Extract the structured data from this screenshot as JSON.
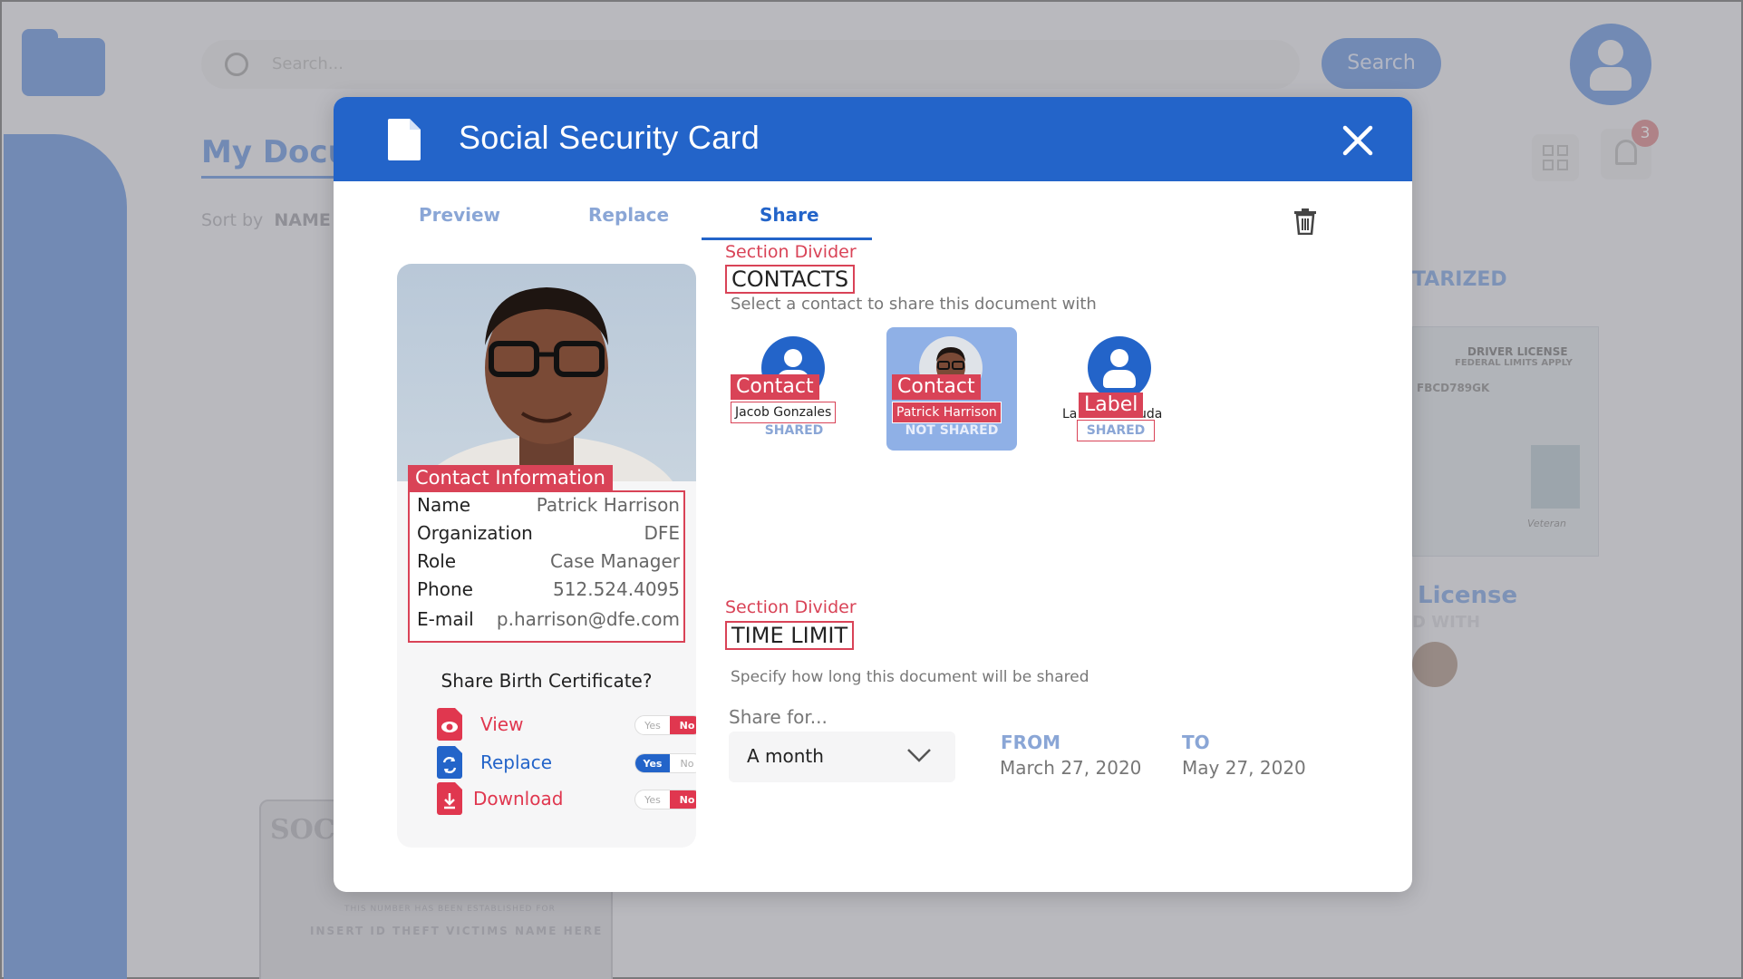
{
  "background": {
    "search_placeholder": "Search...",
    "search_button": "Search",
    "page_title": "My Docu",
    "sort_by_label": "Sort by",
    "sort_by_value": "NAME",
    "notification_count": "3",
    "notarized_label": "TARIZED",
    "dl_card_line1": "DRIVER LICENSE",
    "dl_card_line2": "FEDERAL LIMITS APPLY",
    "dl_card_line3": "FBCD789GK",
    "dl_card_veteran": "Veteran",
    "license_title": "License",
    "shared_with_label": "D WITH",
    "ssc_card_soc": "SOC",
    "ssc_card_line1": "THIS NUMBER HAS BEEN ESTABLISHED FOR",
    "ssc_card_line2": "INSERT ID THEFT VICTIMS NAME HERE"
  },
  "modal": {
    "title": "Social Security Card",
    "tabs": [
      {
        "label": "Preview"
      },
      {
        "label": "Replace"
      },
      {
        "label": "Share"
      }
    ],
    "active_tab": "Share"
  },
  "profile": {
    "contact_info_tag": "Contact Information",
    "fields": [
      {
        "key": "Name",
        "value": "Patrick Harrison"
      },
      {
        "key": "Organization",
        "value": "DFE"
      },
      {
        "key": "Role",
        "value": "Case Manager"
      },
      {
        "key": "Phone",
        "value": "512.524.4095"
      },
      {
        "key": "E-mail",
        "value": "p.harrison@dfe.com"
      }
    ],
    "share_question": "Share Birth Certificate?",
    "permissions": [
      {
        "label": "View",
        "yes": "Yes",
        "no": "No",
        "state": "no"
      },
      {
        "label": "Replace",
        "yes": "Yes",
        "no": "No",
        "state": "yes"
      },
      {
        "label": "Download",
        "yes": "Yes",
        "no": "No",
        "state": "no"
      }
    ]
  },
  "contacts_section": {
    "divider_label": "Section Divider",
    "title": "CONTACTS",
    "subtitle": "Select a contact to share this document with",
    "contacts": [
      {
        "tag": "Contact",
        "name": "Jacob Gonzales",
        "status": "SHARED"
      },
      {
        "tag": "Contact",
        "name": "Patrick Harrison",
        "status": "NOT SHARED"
      },
      {
        "tag": "Label",
        "name_left": "La",
        "name_right": "uda",
        "status": "SHARED"
      }
    ]
  },
  "time_section": {
    "divider_label": "Section Divider",
    "title": "TIME LIMIT",
    "subtitle": "Specify how long this document will be shared",
    "share_for_label": "Share for...",
    "duration": "A month",
    "from_label": "FROM",
    "from_value": "March 27, 2020",
    "to_label": "TO",
    "to_value": "May 27, 2020"
  },
  "colors": {
    "primary": "#2364c9",
    "light_primary": "#8fb0e6",
    "annotation_red": "#d94357",
    "no_red": "#e0374f"
  }
}
